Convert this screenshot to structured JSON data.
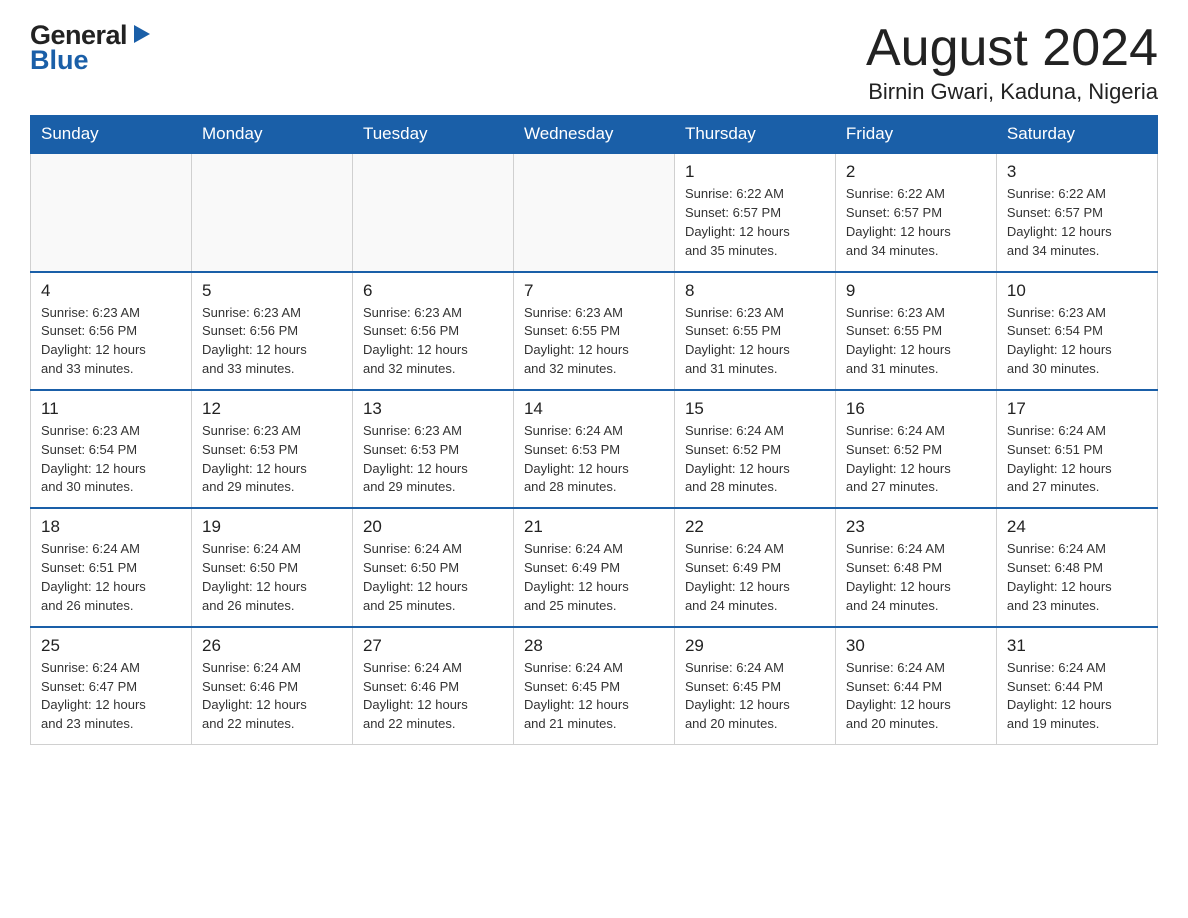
{
  "header": {
    "logo_general": "General",
    "logo_blue": "Blue",
    "month_title": "August 2024",
    "location": "Birnin Gwari, Kaduna, Nigeria"
  },
  "weekdays": [
    "Sunday",
    "Monday",
    "Tuesday",
    "Wednesday",
    "Thursday",
    "Friday",
    "Saturday"
  ],
  "weeks": [
    [
      {
        "day": "",
        "info": ""
      },
      {
        "day": "",
        "info": ""
      },
      {
        "day": "",
        "info": ""
      },
      {
        "day": "",
        "info": ""
      },
      {
        "day": "1",
        "info": "Sunrise: 6:22 AM\nSunset: 6:57 PM\nDaylight: 12 hours\nand 35 minutes."
      },
      {
        "day": "2",
        "info": "Sunrise: 6:22 AM\nSunset: 6:57 PM\nDaylight: 12 hours\nand 34 minutes."
      },
      {
        "day": "3",
        "info": "Sunrise: 6:22 AM\nSunset: 6:57 PM\nDaylight: 12 hours\nand 34 minutes."
      }
    ],
    [
      {
        "day": "4",
        "info": "Sunrise: 6:23 AM\nSunset: 6:56 PM\nDaylight: 12 hours\nand 33 minutes."
      },
      {
        "day": "5",
        "info": "Sunrise: 6:23 AM\nSunset: 6:56 PM\nDaylight: 12 hours\nand 33 minutes."
      },
      {
        "day": "6",
        "info": "Sunrise: 6:23 AM\nSunset: 6:56 PM\nDaylight: 12 hours\nand 32 minutes."
      },
      {
        "day": "7",
        "info": "Sunrise: 6:23 AM\nSunset: 6:55 PM\nDaylight: 12 hours\nand 32 minutes."
      },
      {
        "day": "8",
        "info": "Sunrise: 6:23 AM\nSunset: 6:55 PM\nDaylight: 12 hours\nand 31 minutes."
      },
      {
        "day": "9",
        "info": "Sunrise: 6:23 AM\nSunset: 6:55 PM\nDaylight: 12 hours\nand 31 minutes."
      },
      {
        "day": "10",
        "info": "Sunrise: 6:23 AM\nSunset: 6:54 PM\nDaylight: 12 hours\nand 30 minutes."
      }
    ],
    [
      {
        "day": "11",
        "info": "Sunrise: 6:23 AM\nSunset: 6:54 PM\nDaylight: 12 hours\nand 30 minutes."
      },
      {
        "day": "12",
        "info": "Sunrise: 6:23 AM\nSunset: 6:53 PM\nDaylight: 12 hours\nand 29 minutes."
      },
      {
        "day": "13",
        "info": "Sunrise: 6:23 AM\nSunset: 6:53 PM\nDaylight: 12 hours\nand 29 minutes."
      },
      {
        "day": "14",
        "info": "Sunrise: 6:24 AM\nSunset: 6:53 PM\nDaylight: 12 hours\nand 28 minutes."
      },
      {
        "day": "15",
        "info": "Sunrise: 6:24 AM\nSunset: 6:52 PM\nDaylight: 12 hours\nand 28 minutes."
      },
      {
        "day": "16",
        "info": "Sunrise: 6:24 AM\nSunset: 6:52 PM\nDaylight: 12 hours\nand 27 minutes."
      },
      {
        "day": "17",
        "info": "Sunrise: 6:24 AM\nSunset: 6:51 PM\nDaylight: 12 hours\nand 27 minutes."
      }
    ],
    [
      {
        "day": "18",
        "info": "Sunrise: 6:24 AM\nSunset: 6:51 PM\nDaylight: 12 hours\nand 26 minutes."
      },
      {
        "day": "19",
        "info": "Sunrise: 6:24 AM\nSunset: 6:50 PM\nDaylight: 12 hours\nand 26 minutes."
      },
      {
        "day": "20",
        "info": "Sunrise: 6:24 AM\nSunset: 6:50 PM\nDaylight: 12 hours\nand 25 minutes."
      },
      {
        "day": "21",
        "info": "Sunrise: 6:24 AM\nSunset: 6:49 PM\nDaylight: 12 hours\nand 25 minutes."
      },
      {
        "day": "22",
        "info": "Sunrise: 6:24 AM\nSunset: 6:49 PM\nDaylight: 12 hours\nand 24 minutes."
      },
      {
        "day": "23",
        "info": "Sunrise: 6:24 AM\nSunset: 6:48 PM\nDaylight: 12 hours\nand 24 minutes."
      },
      {
        "day": "24",
        "info": "Sunrise: 6:24 AM\nSunset: 6:48 PM\nDaylight: 12 hours\nand 23 minutes."
      }
    ],
    [
      {
        "day": "25",
        "info": "Sunrise: 6:24 AM\nSunset: 6:47 PM\nDaylight: 12 hours\nand 23 minutes."
      },
      {
        "day": "26",
        "info": "Sunrise: 6:24 AM\nSunset: 6:46 PM\nDaylight: 12 hours\nand 22 minutes."
      },
      {
        "day": "27",
        "info": "Sunrise: 6:24 AM\nSunset: 6:46 PM\nDaylight: 12 hours\nand 22 minutes."
      },
      {
        "day": "28",
        "info": "Sunrise: 6:24 AM\nSunset: 6:45 PM\nDaylight: 12 hours\nand 21 minutes."
      },
      {
        "day": "29",
        "info": "Sunrise: 6:24 AM\nSunset: 6:45 PM\nDaylight: 12 hours\nand 20 minutes."
      },
      {
        "day": "30",
        "info": "Sunrise: 6:24 AM\nSunset: 6:44 PM\nDaylight: 12 hours\nand 20 minutes."
      },
      {
        "day": "31",
        "info": "Sunrise: 6:24 AM\nSunset: 6:44 PM\nDaylight: 12 hours\nand 19 minutes."
      }
    ]
  ]
}
